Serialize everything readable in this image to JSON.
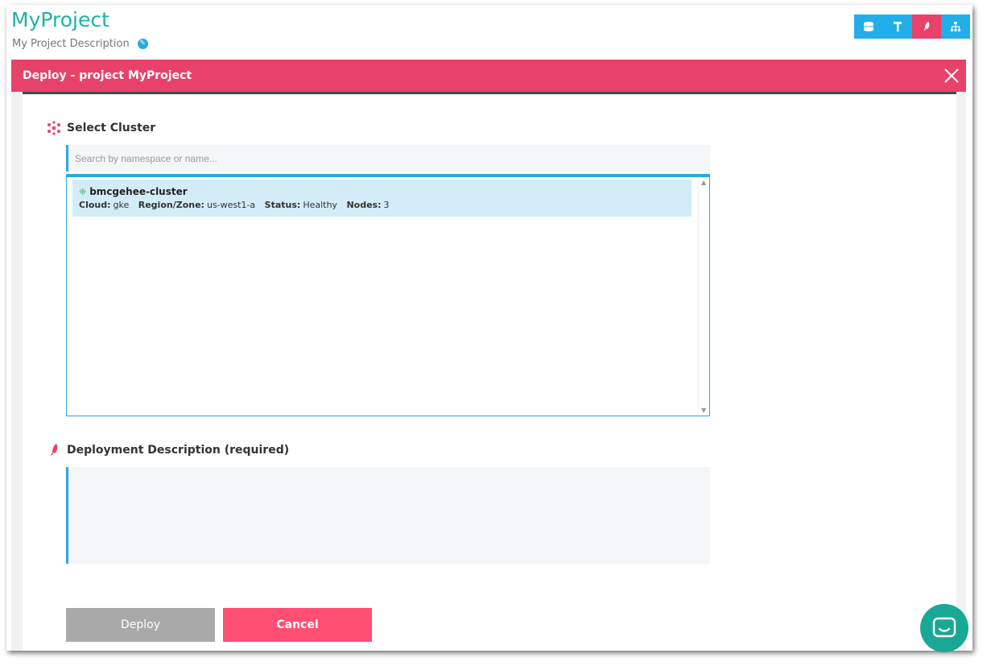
{
  "header": {
    "project_title": "MyProject",
    "project_description": "My Project Description"
  },
  "toolbar": {
    "buttons": [
      {
        "icon": "database-icon"
      },
      {
        "icon": "hammer-icon"
      },
      {
        "icon": "rocket-icon",
        "active": true
      },
      {
        "icon": "sitemap-icon"
      }
    ]
  },
  "modal": {
    "title": "Deploy - project MyProject",
    "select_cluster": {
      "heading": "Select Cluster",
      "search_placeholder": "Search by namespace or name...",
      "clusters": [
        {
          "name": "bmcgehee-cluster",
          "cloud_label": "Cloud:",
          "cloud": "gke",
          "region_label": "Region/Zone:",
          "region": "us-west1-a",
          "status_label": "Status:",
          "status": "Healthy",
          "nodes_label": "Nodes:",
          "nodes": "3"
        }
      ]
    },
    "description": {
      "heading": "Deployment Description (required)",
      "value": ""
    },
    "buttons": {
      "deploy": "Deploy",
      "cancel": "Cancel"
    }
  },
  "colors": {
    "accent_red": "#e8426a",
    "accent_blue": "#22aee8",
    "title_teal": "#1fb1a4",
    "chat_teal": "#1aa896"
  }
}
